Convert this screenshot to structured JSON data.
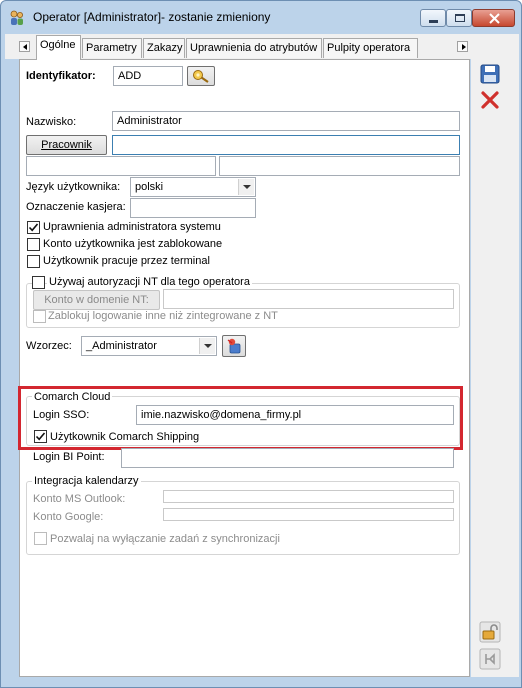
{
  "window": {
    "title": "Operator [Administrator]- zostanie zmieniony"
  },
  "tabs": [
    {
      "label": "Ogólne",
      "active": true
    },
    {
      "label": "Parametry"
    },
    {
      "label": "Zakazy"
    },
    {
      "label": "Uprawnienia do atrybutów"
    },
    {
      "label": "Pulpity operatora"
    }
  ],
  "general": {
    "identifier_label": "Identyfikator:",
    "identifier_value": "ADD",
    "surname_label": "Nazwisko:",
    "surname_value": "Administrator",
    "employee_button": "Pracownik",
    "employee_value": "",
    "language_label": "Język użytkownika:",
    "language_value": "polski",
    "cashier_label": "Oznaczenie kasjera:",
    "cashier_value": "",
    "admin_rights_label": "Uprawnienia administratora systemu",
    "admin_rights_checked": true,
    "account_locked_label": "Konto użytkownika jest zablokowane",
    "account_locked_checked": false,
    "terminal_label": "Użytkownik pracuje przez terminal",
    "terminal_checked": false
  },
  "nt_auth": {
    "use_nt_label": "Używaj autoryzacji NT dla tego operatora",
    "use_nt_checked": false,
    "domain_account_button": "Konto w domenie NT:",
    "domain_account_value": "",
    "block_other_logins_label": "Zablokuj logowanie inne niż zintegrowane z NT",
    "block_other_logins_checked": false
  },
  "template": {
    "label": "Wzorzec:",
    "value": "_Administrator"
  },
  "comarch_cloud": {
    "group_title": "Comarch Cloud",
    "sso_label": "Login SSO:",
    "sso_value": "imie.nazwisko@domena_firmy.pl",
    "shipping_label": "Użytkownik Comarch Shipping",
    "shipping_checked": true,
    "bi_label": "Login BI Point:",
    "bi_value": ""
  },
  "calendar": {
    "group_title": "Integracja kalendarzy",
    "outlook_label": "Konto MS Outlook:",
    "outlook_value": "",
    "google_label": "Konto Google:",
    "google_value": "",
    "allow_disable_label": "Pozwalaj na wyłączanie zadań z synchronizacji",
    "allow_disable_checked": false
  },
  "icons": {
    "save": "save-icon",
    "cancel": "cancel-icon",
    "unlock": "unlock-icon",
    "pin": "pin-icon",
    "search": "key-search-icon",
    "template_action": "template-icon"
  },
  "colors": {
    "highlight_box": "#d32730",
    "window_frame": "#bcd3ea",
    "cancel_red": "#d0312d",
    "save_blue": "#3e6fb7"
  }
}
